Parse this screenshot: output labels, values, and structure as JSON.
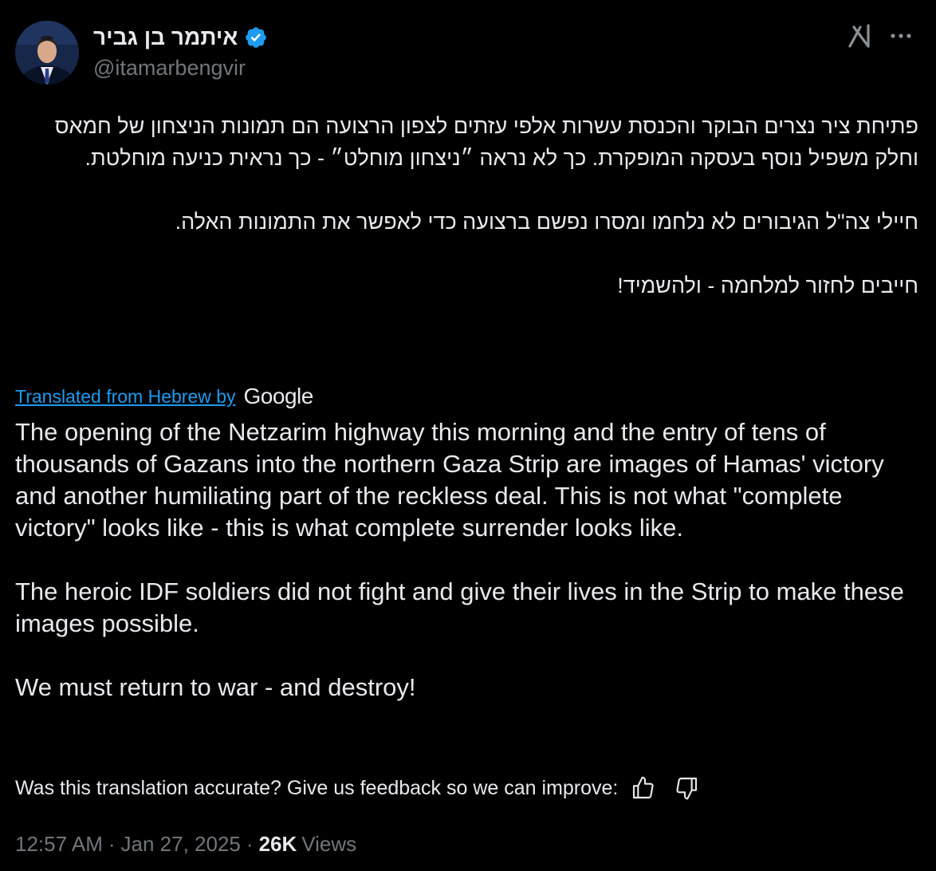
{
  "author": {
    "display_name": "איתמר בן גביר",
    "handle": "@itamarbengvir",
    "verified_icon": "verified-badge-icon",
    "verified_color": "#1d9bf0"
  },
  "header_actions": {
    "grok_icon": "grok-icon",
    "more_icon": "more-icon"
  },
  "tweet": {
    "hebrew_paragraphs": [
      "פתיחת ציר נצרים הבוקר והכנסת עשרות אלפי עזתים לצפון הרצועה הם תמונות הניצחון של חמאס וחלק משפיל נוסף בעסקה המופקרת. כך לא נראה ״ניצחון מוחלט״ - כך נראית כניעה מוחלטת.",
      "חיילי צה\"ל הגיבורים לא נלחמו ומסרו נפשם ברצועה כדי לאפשר את התמונות האלה.",
      "חייבים לחזור למלחמה - ולהשמיד!"
    ],
    "translated_label": "Translated from Hebrew by",
    "translator_logo": "Google",
    "english_paragraphs": [
      "The opening of the Netzarim highway this morning and the entry of tens of thousands of Gazans into the northern Gaza Strip are images of Hamas' victory and another humiliating part of the reckless deal. This is not what \"complete victory\" looks like - this is what complete surrender looks like.",
      "The heroic IDF soldiers did not fight and give their lives in the Strip to make these images possible.",
      "We must return to war - and destroy!"
    ]
  },
  "feedback": {
    "text": "Was this translation accurate? Give us feedback so we can improve:",
    "thumbs_up_icon": "thumbs-up-icon",
    "thumbs_down_icon": "thumbs-down-icon"
  },
  "meta": {
    "time": "12:57 AM",
    "date": "Jan 27, 2025",
    "views_count": "26K",
    "views_label": "Views"
  },
  "colors": {
    "background": "#000000",
    "text": "#e7e9ea",
    "secondary": "#71767b",
    "link": "#1d9bf0"
  }
}
